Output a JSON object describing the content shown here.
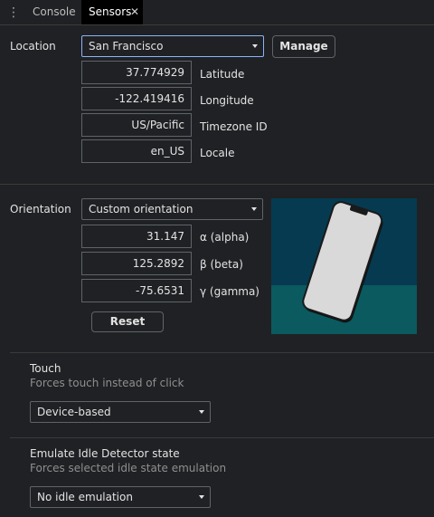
{
  "tabs": [
    {
      "label": "Console"
    },
    {
      "label": "Sensors"
    }
  ],
  "close_glyph": "✕",
  "location": {
    "label": "Location",
    "selected": "San Francisco",
    "manage_label": "Manage",
    "fields": [
      {
        "value": "37.774929",
        "label": "Latitude"
      },
      {
        "value": "-122.419416",
        "label": "Longitude"
      },
      {
        "value": "US/Pacific",
        "label": "Timezone ID"
      },
      {
        "value": "en_US",
        "label": "Locale"
      }
    ]
  },
  "orientation": {
    "label": "Orientation",
    "selected": "Custom orientation",
    "fields": [
      {
        "value": "31.147",
        "label": "α (alpha)"
      },
      {
        "value": "125.2892",
        "label": "β (beta)"
      },
      {
        "value": "-75.6531",
        "label": "γ (gamma)"
      }
    ],
    "reset_label": "Reset"
  },
  "touch": {
    "title": "Touch",
    "subtitle": "Forces touch instead of click",
    "selected": "Device-based"
  },
  "idle": {
    "title": "Emulate Idle Detector state",
    "subtitle": "Forces selected idle state emulation",
    "selected": "No idle emulation"
  },
  "colors": {
    "background": "#202124",
    "focus": "#8ab4f8",
    "sky": "#063a50",
    "ground": "#0a5a60"
  }
}
